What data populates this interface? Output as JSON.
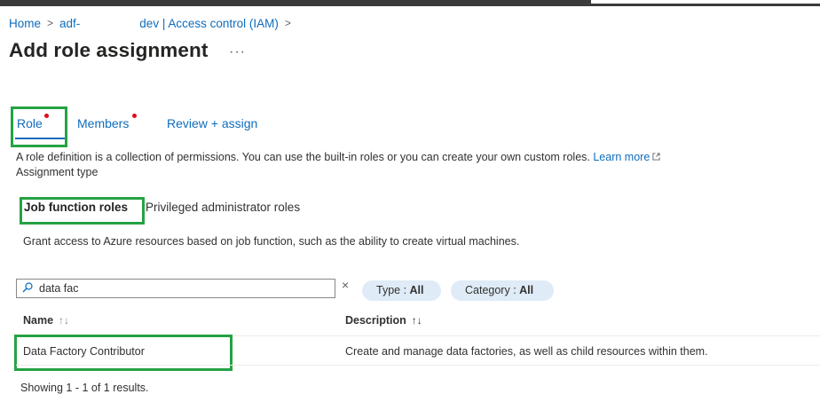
{
  "breadcrumb": {
    "home": "Home",
    "resource_prefix": "adf-",
    "resource_suffix": "dev | Access control (IAM)",
    "separator": ">"
  },
  "page": {
    "title": "Add role assignment",
    "more": "···"
  },
  "tabs": [
    {
      "label": "Role",
      "required": true,
      "selected": true
    },
    {
      "label": "Members",
      "required": true,
      "selected": false
    },
    {
      "label": "Review + assign",
      "required": false,
      "selected": false
    }
  ],
  "role_tab": {
    "description": "A role definition is a collection of permissions. You can use the built-in roles or you can create your own custom roles.",
    "learn_more": "Learn more",
    "assignment_type_label": "Assignment type",
    "assignment_types": [
      {
        "label": "Job function roles",
        "selected": true
      },
      {
        "label": "Privileged administrator roles",
        "selected": false
      }
    ],
    "grant_text": "Grant access to Azure resources based on job function, such as the ability to create virtual machines."
  },
  "search": {
    "value": "data fac",
    "clear": "×"
  },
  "filters": [
    {
      "label": "Type : ",
      "value": "All"
    },
    {
      "label": "Category : ",
      "value": "All"
    }
  ],
  "table": {
    "columns": [
      {
        "label": "Name",
        "sort": "↑↓"
      },
      {
        "label": "Description",
        "sort": "↑↓"
      }
    ],
    "rows": [
      {
        "name": "Data Factory Contributor",
        "description": "Create and manage data factories, as well as child resources within them."
      }
    ],
    "footer": "Showing 1 - 1 of 1 results."
  },
  "colors": {
    "link": "#0f6cbd",
    "highlight": "#25a244",
    "required_dot": "#e00b1c",
    "pill_bg": "#dfecf7"
  }
}
